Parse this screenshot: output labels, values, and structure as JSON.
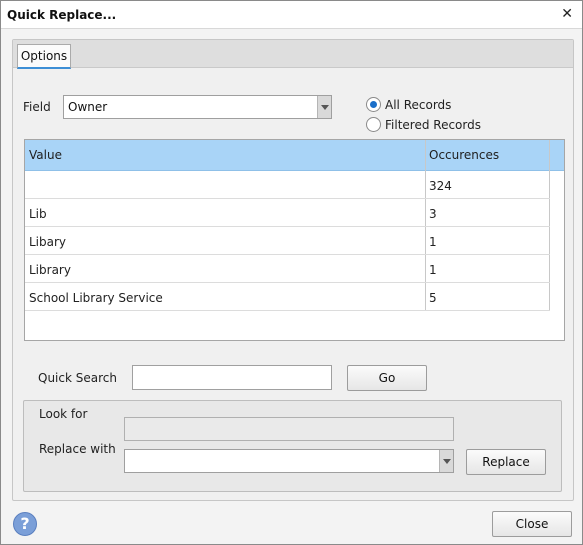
{
  "window": {
    "title": "Quick Replace...",
    "close_glyph": "✕"
  },
  "tabs": [
    {
      "label": "Options",
      "active": true
    }
  ],
  "field": {
    "label": "Field",
    "value": "Owner"
  },
  "scope": {
    "options": [
      {
        "label": "All Records",
        "selected": true
      },
      {
        "label": "Filtered Records",
        "selected": false
      }
    ]
  },
  "grid": {
    "columns": [
      "Value",
      "Occurences"
    ],
    "rows": [
      {
        "value": "",
        "occurrences": "324"
      },
      {
        "value": "Lib",
        "occurrences": "3"
      },
      {
        "value": "Libary",
        "occurrences": "1"
      },
      {
        "value": "Library",
        "occurrences": "1"
      },
      {
        "value": "School Library Service",
        "occurrences": "5"
      }
    ]
  },
  "quick_search": {
    "label": "Quick Search",
    "value": "",
    "go_label": "Go"
  },
  "replace": {
    "look_for_label": "Look for",
    "look_for_value": "",
    "replace_with_label": "Replace with",
    "replace_with_value": "",
    "replace_button": "Replace"
  },
  "footer": {
    "help_glyph": "?",
    "help_icon": "help-icon",
    "close_label": "Close"
  },
  "colors": {
    "header_bg": "#a9d4f7",
    "radio_accent": "#1a6fc9",
    "tab_underline": "#3d8fd6"
  }
}
